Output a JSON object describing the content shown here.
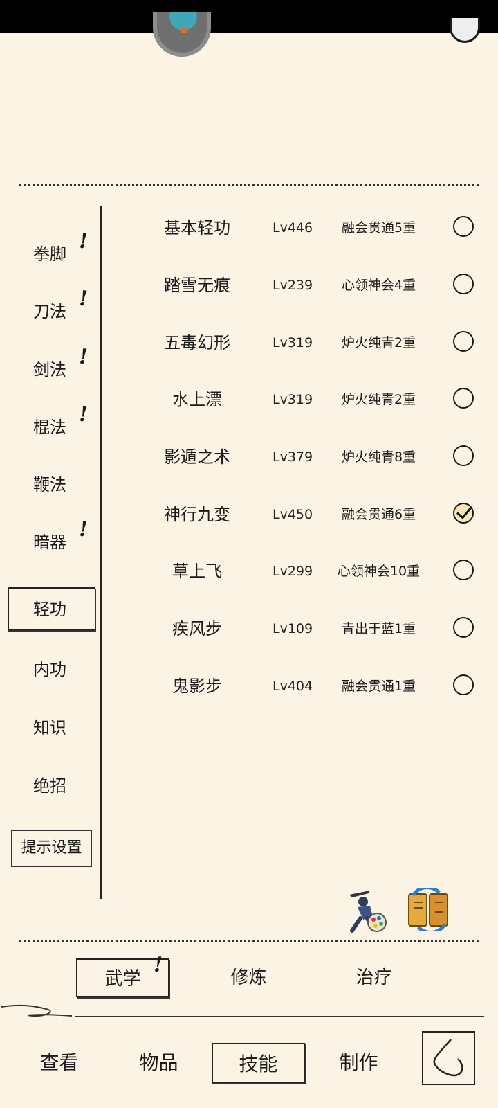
{
  "sidebar": {
    "items": [
      {
        "label": "拳脚",
        "alert": "!"
      },
      {
        "label": "刀法",
        "alert": "!"
      },
      {
        "label": "剑法",
        "alert": "!"
      },
      {
        "label": "棍法",
        "alert": "!"
      },
      {
        "label": "鞭法",
        "alert": ""
      },
      {
        "label": "暗器",
        "alert": "!"
      },
      {
        "label": "轻功",
        "alert": ""
      },
      {
        "label": "内功",
        "alert": ""
      },
      {
        "label": "知识",
        "alert": ""
      },
      {
        "label": "绝招",
        "alert": ""
      }
    ],
    "selected": "轻功",
    "hint_settings": "提示设置"
  },
  "skills": [
    {
      "name": "基本轻功",
      "level": "Lv446",
      "rank": "融会贯通5重",
      "checked": false
    },
    {
      "name": "踏雪无痕",
      "level": "Lv239",
      "rank": "心领神会4重",
      "checked": false
    },
    {
      "name": "五毒幻形",
      "level": "Lv319",
      "rank": "炉火纯青2重",
      "checked": false
    },
    {
      "name": "水上漂",
      "level": "Lv319",
      "rank": "炉火纯青2重",
      "checked": false
    },
    {
      "name": "影遁之术",
      "level": "Lv379",
      "rank": "炉火纯青8重",
      "checked": false
    },
    {
      "name": "神行九变",
      "level": "Lv450",
      "rank": "融会贯通6重",
      "checked": true
    },
    {
      "name": "草上飞",
      "level": "Lv299",
      "rank": "心领神会10重",
      "checked": false
    },
    {
      "name": "疾风步",
      "level": "Lv109",
      "rank": "青出于蓝1重",
      "checked": false
    },
    {
      "name": "鬼影步",
      "level": "Lv404",
      "rank": "融会贯通1重",
      "checked": false
    }
  ],
  "tabs": {
    "wuxue": "武学",
    "wuxue_alert": "!",
    "xiulian": "修炼",
    "zhiliao": "治疗"
  },
  "nav": {
    "view": "查看",
    "items": "物品",
    "skills": "技能",
    "craft": "制作"
  }
}
